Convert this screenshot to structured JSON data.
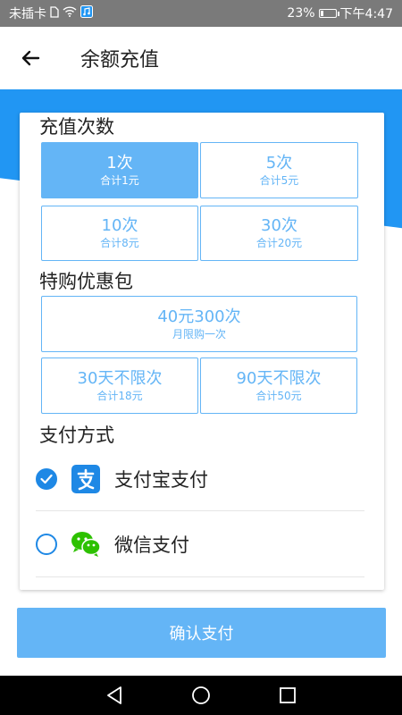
{
  "status_bar": {
    "carrier": "未插卡",
    "battery": "23%",
    "battery_level": 0.23,
    "time": "下午4:47"
  },
  "header": {
    "title": "余额充值",
    "back_icon": "arrow-left-icon"
  },
  "recharge": {
    "section_title": "充值次数",
    "options": [
      {
        "label": "1次",
        "sub": "合计1元",
        "selected": true
      },
      {
        "label": "5次",
        "sub": "合计5元",
        "selected": false
      },
      {
        "label": "10次",
        "sub": "合计8元",
        "selected": false
      },
      {
        "label": "30次",
        "sub": "合计20元",
        "selected": false
      }
    ]
  },
  "special": {
    "section_title": "特购优惠包",
    "options": [
      {
        "label": "40元300次",
        "sub": "月限购一次"
      },
      {
        "label": "30天不限次",
        "sub": "合计18元"
      },
      {
        "label": "90天不限次",
        "sub": "合计50元"
      }
    ]
  },
  "payment": {
    "section_title": "支付方式",
    "methods": [
      {
        "label": "支付宝支付",
        "icon": "alipay-icon",
        "selected": true
      },
      {
        "label": "微信支付",
        "icon": "wechat-icon",
        "selected": false
      }
    ]
  },
  "confirm_label": "确认支付",
  "colors": {
    "accent": "#2196f3",
    "option_blue": "#64b5f6",
    "radio_blue": "#1e88e5",
    "wechat_green": "#2dc100"
  }
}
